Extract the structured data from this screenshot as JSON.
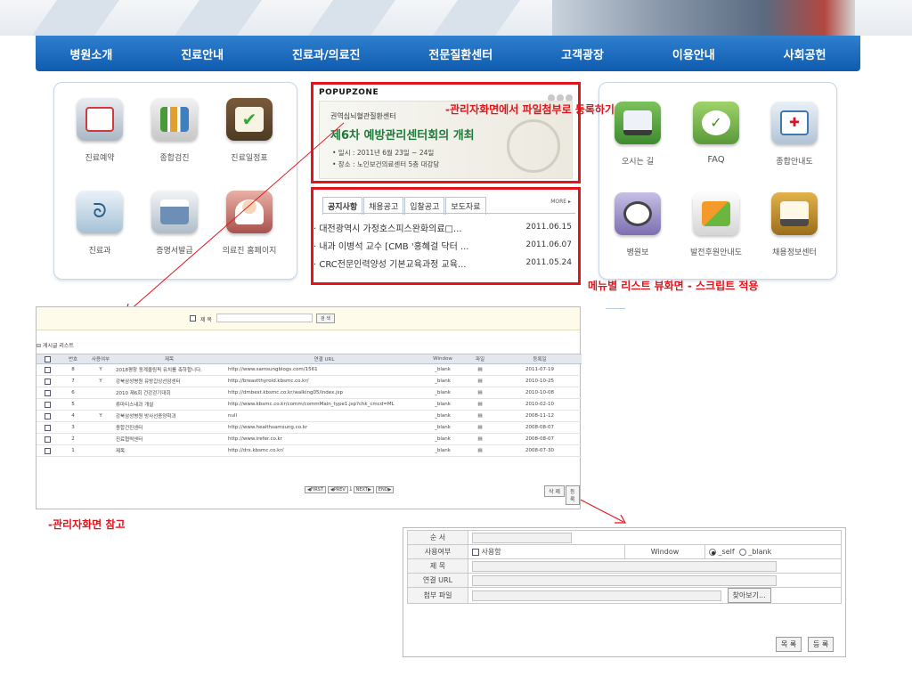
{
  "nav": [
    "병원소개",
    "진료안내",
    "진료과/의료진",
    "전문질환센터",
    "고객광장",
    "이용안내",
    "사회공헌"
  ],
  "left_icons": [
    {
      "label": "진료예약",
      "icon": "calendar-icon",
      "color": "#4a7fb0"
    },
    {
      "label": "종합검진",
      "icon": "chart-person-icon",
      "color": "#6b8a3e"
    },
    {
      "label": "진료일정표",
      "icon": "checklist-icon",
      "color": "#8a6a3a"
    },
    {
      "label": "진료과",
      "icon": "stethoscope-icon",
      "color": "#3e7aa0"
    },
    {
      "label": "증명서발급",
      "icon": "printer-icon",
      "color": "#4b6f96"
    },
    {
      "label": "의료진 홈페이지",
      "icon": "doctor-icon",
      "color": "#a04a46"
    }
  ],
  "right_icons": [
    {
      "label": "오시는 길",
      "icon": "bus-icon",
      "color": "#4c8a3a"
    },
    {
      "label": "FAQ",
      "icon": "speech-bubble-icon",
      "color": "#5c9a3c"
    },
    {
      "label": "종합안내도",
      "icon": "first-aid-icon",
      "color": "#3f79ad"
    },
    {
      "label": "병원보",
      "icon": "magnifier-icon",
      "color": "#6a5a9a"
    },
    {
      "label": "발전후원안내도",
      "icon": "puzzle-icon",
      "color": "#d0762a"
    },
    {
      "label": "채용정보센터",
      "icon": "id-card-icon",
      "color": "#9a7a2a"
    }
  ],
  "popup": {
    "title": "POPUPZONE",
    "org": "권역심뇌혈관질환센터",
    "headline": "제6차 예방관리센터회의 개최",
    "line1": "• 일시 : 2011년 6월 23일 ~ 24일",
    "line2": "• 장소 : 노인보건의료센터 5층 대강당"
  },
  "annotation_top": "-관리자화면에서 파일첨부로 등록하기",
  "annotation_right": "메뉴별 리스트 뷰화면 - 스크립트 적용",
  "annotation_admin": "-관리자화면 참고",
  "notice": {
    "tabs": [
      "공지사항",
      "채용공고",
      "입찰공고",
      "보도자료"
    ],
    "more": "MORE ▸",
    "items": [
      {
        "title": "· 대전광역시 가정호스피스완화의료□...",
        "date": "2011.06.15"
      },
      {
        "title": "· 내과 이병석 교수 [CMB '홍혜걸 닥터 ...",
        "date": "2011.06.07"
      },
      {
        "title": "· CRC전문인력양성 기본교육과정 교육...",
        "date": "2011.05.24"
      }
    ]
  },
  "admin_list": {
    "search_label": "제 목",
    "search_button": "검 색",
    "section_title": "⊟ 게시글 리스트",
    "headers": [
      "",
      "번호",
      "사용여부",
      "제목",
      "연결 URL",
      "Window",
      "파일",
      "등록일"
    ],
    "rows": [
      {
        "no": "8",
        "use": "Y",
        "title": "2018평창 동계올림픽 유치를 축하합니다.",
        "url": "http://www.samsungblogs.com/1561",
        "win": "_blank",
        "date": "2011-07-19"
      },
      {
        "no": "7",
        "use": "Y",
        "title": "강북삼성병원 유방갑상선암센터",
        "url": "http://breastthyroid.kbsmc.co.kr/",
        "win": "_blank",
        "date": "2010-10-25"
      },
      {
        "no": "6",
        "use": "",
        "title": "2010 제6회 건강걷기대회",
        "url": "http://dmbest.kbsmc.co.kr/walking05/index.jsp",
        "win": "_blank",
        "date": "2010-10-08"
      },
      {
        "no": "5",
        "use": "",
        "title": "류마티스내과 개설",
        "url": "http://www.kbsmc.co.kr/comm/commMain_type1.jsp?chk_cmcd=ML",
        "win": "_blank",
        "date": "2010-02-10"
      },
      {
        "no": "4",
        "use": "Y",
        "title": "강북삼성병원 방사선종양학과",
        "url": "null",
        "win": "_blank",
        "date": "2008-11-12"
      },
      {
        "no": "3",
        "use": "",
        "title": "종합건진센터",
        "url": "http://www.healthsamsung.co.kr",
        "win": "_blank",
        "date": "2008-08-07"
      },
      {
        "no": "2",
        "use": "",
        "title": "진료협력센터",
        "url": "http://www.irefer.co.kr",
        "win": "_blank",
        "date": "2008-08-07"
      },
      {
        "no": "1",
        "use": "",
        "title": "제목",
        "url": "http://drx.kbsmc.co.kr/",
        "win": "_blank",
        "date": "2008-07-30"
      }
    ],
    "pager": [
      "◀FIRST",
      "◀PREV",
      "1",
      "NEXT▶",
      "END▶"
    ],
    "delete_button": "삭 제",
    "register_button": "등 록"
  },
  "form": {
    "order_label": "순 서",
    "use_label": "사용여부",
    "use_check": "사용함",
    "window_label": "Window",
    "self_option": "_self",
    "blank_option": "_blank",
    "title_label": "제 목",
    "url_label": "연결 URL",
    "file_label": "첨부 파일",
    "browse_button": "찾아보기...",
    "list_button": "목 록",
    "register_button": "등 록"
  }
}
